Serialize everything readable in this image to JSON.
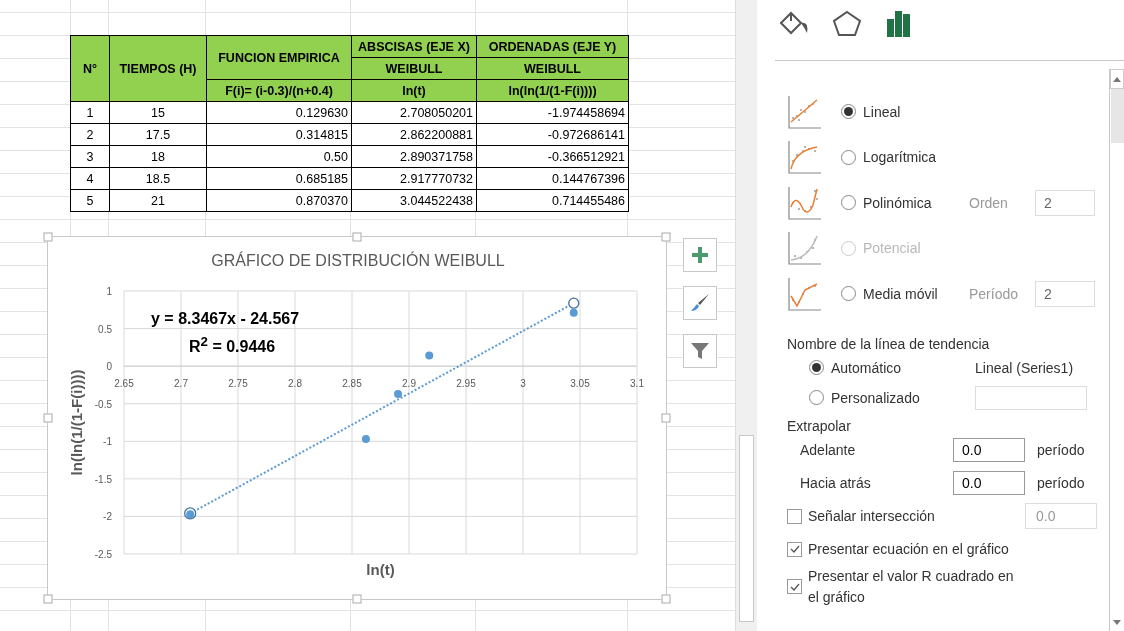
{
  "table": {
    "columns": [
      {
        "heading": "N°"
      },
      {
        "heading": "TIEMPOS (H)"
      },
      {
        "heading": "FUNCION EMPIRICA",
        "formula": "F(i)= (i-0.3)/(n+0.4)"
      },
      {
        "heading": "ABSCISAS (EJE X)",
        "subheading": "WEIBULL",
        "formula": "ln(t)"
      },
      {
        "heading": "ORDENADAS (EJE Y)",
        "subheading": "WEIBULL",
        "formula": "ln(ln(1/(1-F(i))))"
      }
    ],
    "rows": [
      [
        "1",
        "15",
        "0.129630",
        "2.708050201",
        "-1.974458694"
      ],
      [
        "2",
        "17.5",
        "0.314815",
        "2.862200881",
        "-0.972686141"
      ],
      [
        "3",
        "18",
        "0.50",
        "2.890371758",
        "-0.366512921"
      ],
      [
        "4",
        "18.5",
        "0.685185",
        "2.917770732",
        "0.144767396"
      ],
      [
        "5",
        "21",
        "0.870370",
        "3.044522438",
        "0.714455486"
      ]
    ]
  },
  "chart": {
    "chart_data": {
      "type": "scatter",
      "title": "GRÁFICO DE DISTRIBUCIÓN WEIBULL",
      "xlabel": "ln(t)",
      "ylabel": "ln(ln(1/(1-F(i))))",
      "x": [
        2.708050201,
        2.862200881,
        2.890371758,
        2.917770732,
        3.044522438
      ],
      "series": [
        {
          "color": "#5b9bd5",
          "values": [
            -1.97,
            -0.97,
            -0.37,
            0.14,
            0.71
          ]
        }
      ],
      "grid": true,
      "xlim": [
        2.65,
        3.1
      ],
      "ylim": [
        -2.5,
        1
      ],
      "xticks": [
        2.65,
        2.7,
        2.75,
        2.8,
        2.85,
        2.9,
        2.95,
        3,
        3.05,
        3.1
      ],
      "yticks": [
        1,
        0.5,
        0,
        -0.5,
        -1,
        -1.5,
        -2,
        -2.5
      ],
      "annotations": [
        {
          "text": "y = 8.3467x - 24.567"
        },
        {
          "text": "R$^{2}$ = 0.9446"
        }
      ]
    }
  },
  "panel": {
    "tabs": [
      {
        "selected": false
      },
      {
        "selected": false
      },
      {
        "selected": true
      }
    ],
    "trend_types": [
      {
        "label": "Lineal",
        "selected": true,
        "disabled": false
      },
      {
        "label": "Logarítmica",
        "selected": false,
        "disabled": false
      },
      {
        "label": "Polinómica",
        "selected": false,
        "disabled": false,
        "option_label": "Orden",
        "option_value": "2"
      },
      {
        "label": "Potencial",
        "selected": false,
        "disabled": true
      },
      {
        "label": "Media móvil",
        "selected": false,
        "disabled": false,
        "option_label": "Período",
        "option_value": "2"
      }
    ],
    "name_section": {
      "title": "Nombre de la línea de tendencia",
      "options": [
        {
          "label": "Automático",
          "selected": true,
          "value": "Lineal (Series1)"
        },
        {
          "label": "Personalizado",
          "selected": false
        }
      ]
    },
    "extrapolate": {
      "title": "Extrapolar",
      "fields": [
        {
          "label": "Adelante",
          "value": "0.0",
          "unit": "período"
        },
        {
          "label": "Hacia atrás",
          "value": "0.0",
          "unit": "período"
        }
      ]
    },
    "checks": [
      {
        "label": "Señalar intersección",
        "checked": false,
        "value": "0.0"
      },
      {
        "label": "Presentar ecuación en el gráfico",
        "checked": true
      },
      {
        "label": "Presentar el valor R cuadrado en el gráfico",
        "checked": true
      }
    ]
  }
}
